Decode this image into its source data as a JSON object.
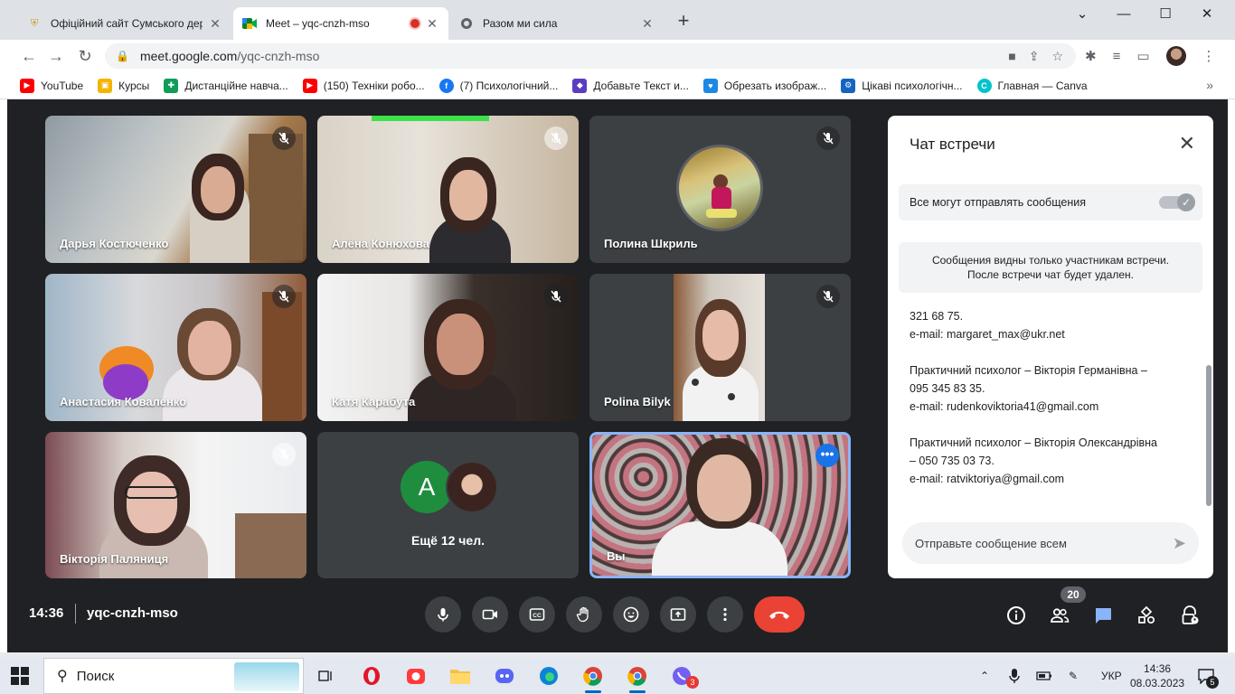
{
  "browser": {
    "tabs": [
      {
        "title": "Офіційний сайт Сумського держ"
      },
      {
        "title": "Meet – yqc-cnzh-mso"
      },
      {
        "title": "Разом ми сила"
      }
    ],
    "url_domain": "meet.google.com",
    "url_path": "/yqc-cnzh-mso",
    "bookmarks": [
      {
        "label": "YouTube",
        "color": "#ff0000",
        "icon": "youtube-icon"
      },
      {
        "label": "Курсы",
        "color": "#2e7d32",
        "icon": "classroom-icon"
      },
      {
        "label": "Дистанційне навча...",
        "color": "#0f9d58",
        "icon": "plus-icon"
      },
      {
        "label": "(150) Техніки робо...",
        "color": "#ff0000",
        "icon": "youtube-icon"
      },
      {
        "label": "(7) Психологічний...",
        "color": "#1877f2",
        "icon": "facebook-icon"
      },
      {
        "label": "Добавьте Текст и...",
        "color": "#5b3cc4",
        "icon": "shield-icon"
      },
      {
        "label": "Обрезать изображ...",
        "color": "#1e88e5",
        "icon": "heart-icon"
      },
      {
        "label": "Цікаві психологічн...",
        "color": "#1565c0",
        "icon": "settings-icon"
      },
      {
        "label": "Главная — Canva",
        "color": "#00c4cc",
        "icon": "chrome-icon"
      }
    ]
  },
  "meet": {
    "participants": [
      {
        "name": "Дарья Костюченко"
      },
      {
        "name": "Алёна Конюхова"
      },
      {
        "name": "Полина Шкриль"
      },
      {
        "name": "Анастасия Коваленко"
      },
      {
        "name": "Катя Карабута"
      },
      {
        "name": "Polina Bilyk"
      },
      {
        "name": "Вікторія Паляниця"
      },
      {
        "name": "Вы"
      }
    ],
    "more_avatar_letter": "A",
    "more_label": "Ещё 12 чел.",
    "time": "14:36",
    "meeting_code": "yqc-cnzh-mso",
    "participant_count": "20",
    "hangup_color": "#ea4335"
  },
  "chat": {
    "title": "Чат встречи",
    "toggle_label": "Все могут отправлять сообщения",
    "toggle_on": true,
    "notice_line1": "Сообщения видны только участникам встречи.",
    "notice_line2": "После встречи чат будет удален.",
    "messages": [
      "321 68 75.",
      "e-mail: margaret_max@ukr.net",
      "",
      "Практичний психолог – Вікторія Германівна –",
      "095 345 83 35.",
      "e-mail: rudenkoviktoria41@gmail.com",
      "",
      "Практичний психолог – Вікторія Олександрівна",
      "– 050 735 03 73.",
      "e-mail: ratviktoriya@gmail.com"
    ],
    "input_placeholder": "Отправьте сообщение всем"
  },
  "taskbar": {
    "search_label": "Поиск",
    "language": "УКР",
    "time": "14:36",
    "date": "08.03.2023",
    "viber_badge": "3",
    "notif_badge": "5"
  }
}
